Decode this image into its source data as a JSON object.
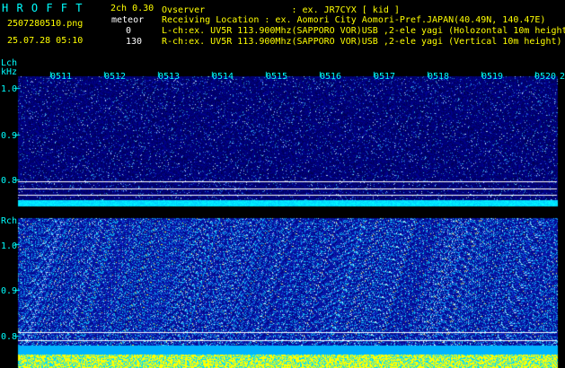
{
  "header": {
    "app_title": "H R O F F T",
    "channel_info": "2ch 0.30",
    "filename": "2507280510.png",
    "datetime": "25.07.28 05:10",
    "meteor_label": "meteor",
    "meteor_count_l": "0",
    "meteor_count_r": "130",
    "observer": "Ovserver                : ex. JR7CYX [ kid ]",
    "location": "Receiving Location : ex. Aomori City Aomori-Pref.JAPAN(40.49N, 140.47E)",
    "lch_desc": "L-ch:ex. UV5R 113.900Mhz(SAPPORO VOR)USB ,2-ele yagi (Holozontal 10m height",
    "rch_desc": "R-ch:ex. UV5R 113.900Mhz(SAPPORO VOR)USB ,2-ele yagi (Vertical 10m height)"
  },
  "colors": {
    "label_cyan": "#00ffff",
    "highlight_yellow": "#ffff00",
    "text_white": "#ffffff",
    "background": "#000000",
    "spectrum_navy": "#00007a"
  },
  "lch_panel": {
    "channel_label": "Lch",
    "unit_label": "kHz",
    "y_ticks": [
      "1.0",
      "0.9",
      "0.8"
    ],
    "time_ticks": [
      "0511",
      "0512",
      "0513",
      "0514",
      "0515",
      "0516",
      "0517",
      "0518",
      "0519",
      "0520",
      "2"
    ]
  },
  "rch_panel": {
    "channel_label": "Rch",
    "y_ticks": [
      "1.0",
      "0.9",
      "0.8"
    ]
  }
}
